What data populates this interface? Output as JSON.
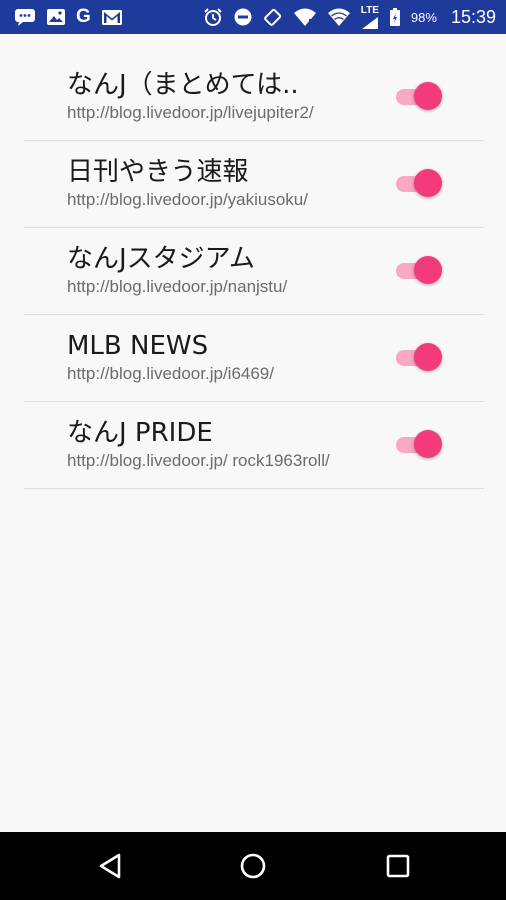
{
  "status_bar": {
    "time": "15:39",
    "battery": "98%",
    "network": "LTE",
    "left_icons": [
      "message-icon",
      "gallery-icon",
      "google-icon",
      "gmail-icon"
    ],
    "right_icons": [
      "alarm-icon",
      "do-not-disturb-icon",
      "rotate-icon",
      "wifi-calling-icon",
      "wifi-icon",
      "signal-icon",
      "battery-icon"
    ],
    "google_letter": "G"
  },
  "blogs": [
    {
      "title": "なんJ（まとめては..",
      "url": "http://blog.livedoor.jp/livejupiter2/",
      "enabled": true
    },
    {
      "title": "日刊やきう速報",
      "url": "http://blog.livedoor.jp/yakiusoku/",
      "enabled": true
    },
    {
      "title": "なんJスタジアム",
      "url": "http://blog.livedoor.jp/nanjstu/",
      "enabled": true
    },
    {
      "title": "MLB NEWS",
      "url": "http://blog.livedoor.jp/i6469/",
      "enabled": true
    },
    {
      "title": "なんJ PRIDE",
      "url": "http://blog.livedoor.jp/ rock1963roll/",
      "enabled": true
    }
  ],
  "colors": {
    "status_bar": "#1e3a9a",
    "accent": "#f33a7a",
    "accent_track": "#f6a9c0",
    "background": "#f8f8f8"
  },
  "nav_bar": {
    "buttons": [
      "back-icon",
      "home-icon",
      "recents-icon"
    ]
  }
}
